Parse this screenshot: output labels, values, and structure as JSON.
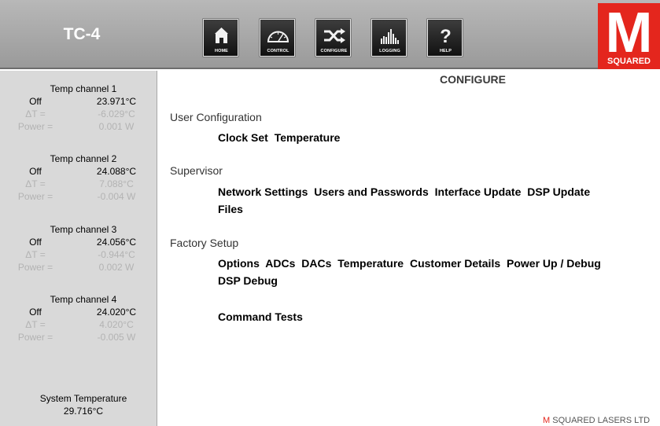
{
  "header": {
    "device_title": "TC-4",
    "nav": [
      {
        "label": "HOME",
        "icon": "home-icon"
      },
      {
        "label": "CONTROL",
        "icon": "gauge-icon"
      },
      {
        "label": "CONFIGURE",
        "icon": "shuffle-icon"
      },
      {
        "label": "LOGGING",
        "icon": "bar-chart-icon"
      },
      {
        "label": "HELP",
        "icon": "question-icon"
      }
    ],
    "logo": {
      "letter": "M",
      "word": "SQUARED",
      "color": "#e4261d"
    }
  },
  "sidebar": {
    "channels": [
      {
        "title": "Temp channel 1",
        "state": "Off",
        "temp": "23.971°C",
        "delta_label": "ΔT =",
        "delta": "-6.029°C",
        "power_label": "Power =",
        "power": "0.001 W"
      },
      {
        "title": "Temp channel 2",
        "state": "Off",
        "temp": "24.088°C",
        "delta_label": "ΔT =",
        "delta": "7.088°C",
        "power_label": "Power =",
        "power": "-0.004 W"
      },
      {
        "title": "Temp channel 3",
        "state": "Off",
        "temp": "24.056°C",
        "delta_label": "ΔT =",
        "delta": "-0.944°C",
        "power_label": "Power =",
        "power": "0.002 W"
      },
      {
        "title": "Temp channel 4",
        "state": "Off",
        "temp": "24.020°C",
        "delta_label": "ΔT =",
        "delta": "4.020°C",
        "power_label": "Power =",
        "power": "-0.005 W"
      }
    ],
    "system": {
      "label": "System Temperature",
      "value": "29.716°C"
    }
  },
  "main": {
    "title": "CONFIGURE",
    "sections": [
      {
        "heading": "User Configuration",
        "rows": [
          [
            "Clock Set",
            "Temperature"
          ]
        ]
      },
      {
        "heading": "Supervisor",
        "rows": [
          [
            "Network Settings",
            "Users and Passwords",
            "Interface Update",
            "DSP Update"
          ],
          [
            "Files"
          ]
        ]
      },
      {
        "heading": "Factory Setup",
        "rows": [
          [
            "Options",
            "ADCs",
            "DACs",
            "Temperature",
            "Customer Details",
            "Power Up / Debug"
          ],
          [
            "DSP Debug"
          ],
          [
            "Command Tests"
          ]
        ]
      }
    ]
  },
  "footer": {
    "brand_accent": "M",
    "brand_rest": " SQUARED LASERS LTD"
  },
  "colors": {
    "accent": "#e4261d",
    "sidebar_bg": "#d9d9d9",
    "header_bg": "#a8a8a8"
  }
}
